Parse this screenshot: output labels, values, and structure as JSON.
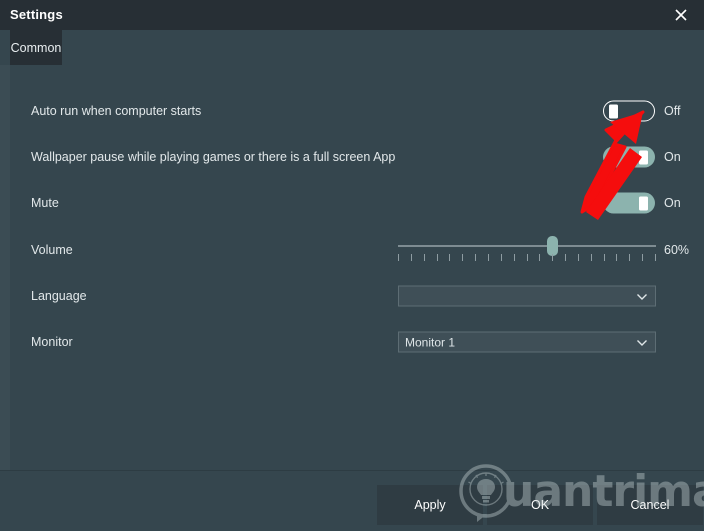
{
  "window": {
    "title": "Settings",
    "close_icon": "close-icon"
  },
  "tabs": [
    {
      "label": "Common",
      "active": true
    }
  ],
  "settings": {
    "rows": [
      {
        "label": "Auto run when computer starts",
        "control": "toggle",
        "state": "Off",
        "on": false
      },
      {
        "label": "Wallpaper pause while playing games or there is a full screen App",
        "control": "toggle",
        "state": "On",
        "on": true
      },
      {
        "label": "Mute",
        "control": "toggle",
        "state": "On",
        "on": true
      },
      {
        "label": "Volume",
        "control": "slider",
        "value": "60%",
        "percent": 60,
        "ticks": 21
      },
      {
        "label": "Language",
        "control": "dropdown",
        "value": "",
        "arrow_icon": "chevron-down-icon"
      },
      {
        "label": "Monitor",
        "control": "dropdown",
        "value": "Monitor 1",
        "arrow_icon": "chevron-down-icon"
      }
    ]
  },
  "footer": {
    "buttons": [
      {
        "label": "Apply"
      },
      {
        "label": "OK"
      },
      {
        "label": "Cancel"
      }
    ]
  },
  "watermark": {
    "text": "uantrimang",
    "logo_icon": "lightbulb-logo-icon"
  },
  "annotation": {
    "arrow_icon": "red-arrow-up-right-icon",
    "color": "#f50d0d"
  },
  "colors": {
    "titlebar": "#272f35",
    "content": "#35464e",
    "accent": "#5c9a97",
    "toggle_on": "#8cb3ae",
    "button": "#2f3c43",
    "annotation_red": "#f50d0d"
  }
}
